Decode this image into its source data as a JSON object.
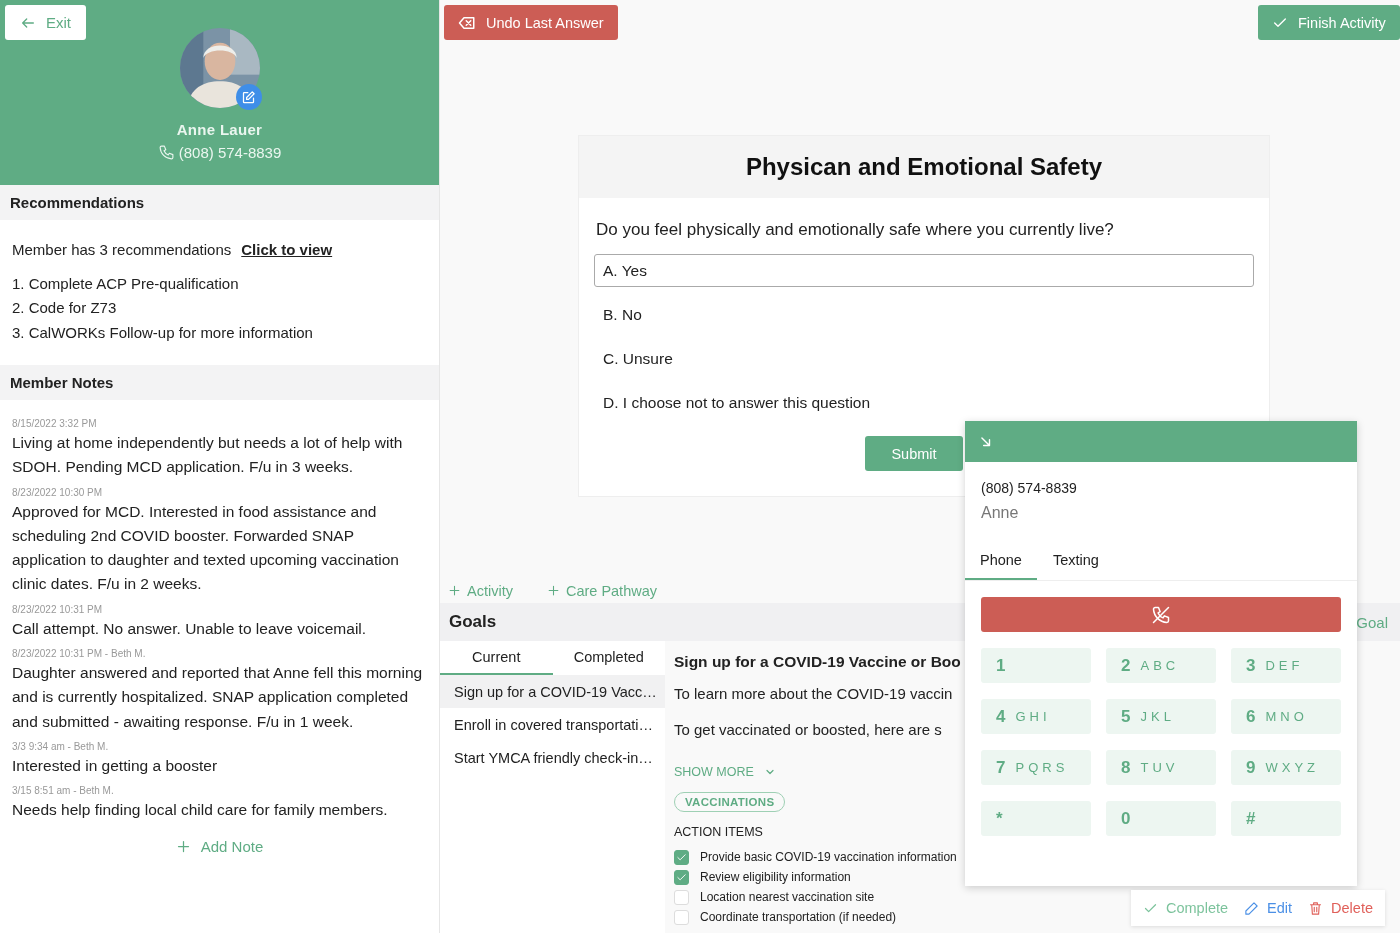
{
  "sidebar": {
    "exit_button": "Exit",
    "member": {
      "name": "Anne Lauer",
      "phone": "(808) 574-8839"
    },
    "recommendations": {
      "title": "Recommendations",
      "summary": "Member has 3 recommendations",
      "link": "Click to view",
      "items": [
        "1. Complete ACP Pre-qualification",
        "2. Code for Z73",
        "3. CalWORKs Follow-up for more information"
      ]
    },
    "member_notes": {
      "title": "Member Notes",
      "add_button": "Add Note",
      "notes": [
        {
          "meta": "8/15/2022 3:32 PM",
          "text": "Living at home independently but needs a lot of help with SDOH. Pending MCD application. F/u in 3 weeks."
        },
        {
          "meta": "8/23/2022 10:30 PM",
          "text": "Approved for MCD. Interested in food assistance and scheduling 2nd COVID booster. Forwarded SNAP application to daughter and texted upcoming vaccination clinic dates. F/u in 2 weeks."
        },
        {
          "meta": "8/23/2022 10:31 PM",
          "text": "Call attempt. No answer. Unable to leave voicemail."
        },
        {
          "meta": "8/23/2022 10:31 PM - Beth M.",
          "text": "Daughter answered and reported that Anne fell this morning and is currently hospitalized. SNAP application completed and submitted - awaiting response. F/u in 1 week."
        },
        {
          "meta": "3/3 9:34 am - Beth M.",
          "text": "Interested in getting a booster"
        },
        {
          "meta": "3/15 8:51 am - Beth M.",
          "text": "Needs help finding local child care for family members."
        }
      ]
    }
  },
  "toolbar": {
    "undo_button": "Undo Last Answer",
    "finish_button": "Finish Activity"
  },
  "question_card": {
    "title": "Physican and Emotional Safety",
    "question": "Do you feel physically and emotionally safe where you currently live?",
    "submit_button": "Submit",
    "options": [
      {
        "label": "A. Yes",
        "selected": true
      },
      {
        "label": "B. No",
        "selected": false
      },
      {
        "label": "C. Unsure",
        "selected": false
      },
      {
        "label": "D. I choose not to answer this question",
        "selected": false
      }
    ]
  },
  "activity_actions": [
    "Activity",
    "Care Pathway"
  ],
  "goals": {
    "title": "Goals",
    "add_goal": "Goal",
    "tabs": [
      {
        "label": "Current",
        "selected": true
      },
      {
        "label": "Completed",
        "selected": false
      }
    ],
    "items": [
      {
        "label": "Sign up for a COVID-19 Vacc…",
        "selected": true
      },
      {
        "label": "Enroll in covered transportati…",
        "selected": false
      },
      {
        "label": "Start YMCA friendly check-in…",
        "selected": false
      }
    ],
    "detail": {
      "title": "Sign up for a COVID-19 Vaccine or Boo",
      "paragraphs": [
        "To learn more about the COVID-19 vaccin",
        "To get vaccinated or boosted, here are s"
      ],
      "show_more": "SHOW MORE",
      "tag": "VACCINATIONS",
      "action_items_title": "ACTION ITEMS",
      "action_items": [
        {
          "label": "Provide basic COVID-19 vaccination information",
          "checked": true
        },
        {
          "label": "Review eligibility information",
          "checked": true
        },
        {
          "label": "Location nearest vaccination site",
          "checked": false
        },
        {
          "label": "Coordinate transportation (if needed)",
          "checked": false
        }
      ]
    },
    "actions": [
      {
        "label": "Complete",
        "kind": "complete"
      },
      {
        "label": "Edit",
        "kind": "edit"
      },
      {
        "label": "Delete",
        "kind": "delete"
      }
    ]
  },
  "dialer": {
    "phone": "(808) 574-8839",
    "name": "Anne",
    "tabs": [
      {
        "label": "Phone",
        "selected": true
      },
      {
        "label": "Texting",
        "selected": false
      }
    ],
    "keys": [
      {
        "digit": "1"
      },
      {
        "digit": "2",
        "letters": "ABC"
      },
      {
        "digit": "3",
        "letters": "DEF"
      },
      {
        "digit": "4",
        "letters": "GHI"
      },
      {
        "digit": "5",
        "letters": "JKL"
      },
      {
        "digit": "6",
        "letters": "MNO"
      },
      {
        "digit": "7",
        "letters": "PQRS"
      },
      {
        "digit": "8",
        "letters": "TUV"
      },
      {
        "digit": "9",
        "letters": "WXYZ"
      },
      {
        "digit": "*"
      },
      {
        "digit": "0"
      },
      {
        "digit": "#"
      }
    ]
  }
}
